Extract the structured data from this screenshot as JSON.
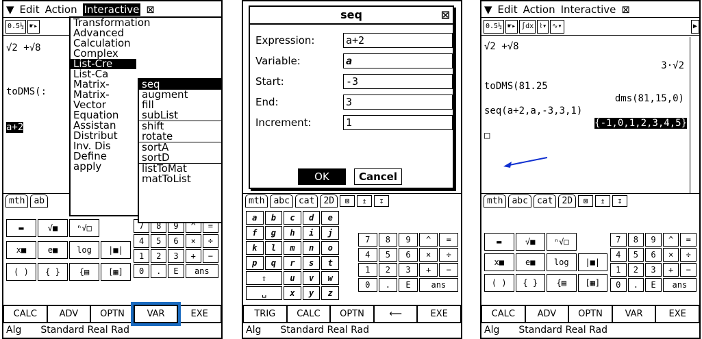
{
  "p1": {
    "menubar": {
      "down_icon": "▼",
      "edit": "Edit",
      "action": "Action",
      "interactive": "Interactive",
      "close": "⊠"
    },
    "menu": [
      "Transformation",
      "Advanced",
      "Calculation",
      "Complex",
      "List-Cre",
      "List-Ca",
      "Matrix-",
      "Matrix-",
      "Vector",
      "Equation",
      "Assistan",
      "Distribut",
      "Inv. Dis",
      "Define",
      "apply"
    ],
    "submenu": [
      "seq",
      "augment",
      "fill",
      "subList",
      "shift",
      "rotate",
      "sortA",
      "sortD",
      "listToMat",
      "matToList"
    ],
    "work": [
      "√2 +√8",
      "toDMS(:",
      "a+2"
    ],
    "tabs": [
      "mth",
      "ab"
    ],
    "bottom": [
      "CALC",
      "ADV",
      "OPTN",
      "VAR",
      "EXE"
    ],
    "status": [
      "Alg",
      "Standard Real Rad"
    ]
  },
  "p2": {
    "title": "seq",
    "fields": [
      {
        "label": "Expression:",
        "value": "a+2"
      },
      {
        "label": "Variable:",
        "value": "a"
      },
      {
        "label": "Start:",
        "value": "-3"
      },
      {
        "label": "End:",
        "value": "3"
      },
      {
        "label": "Increment:",
        "value": "1"
      }
    ],
    "ok": "OK",
    "cancel": "Cancel",
    "tabs": [
      "mth",
      "abc",
      "cat",
      "2D"
    ],
    "letters": [
      "a",
      "b",
      "c",
      "d",
      "e",
      "f",
      "g",
      "h",
      "i",
      "j",
      "k",
      "l",
      "m",
      "n",
      "o",
      "p",
      "q",
      "r",
      "s",
      "t",
      "u",
      "v",
      "w",
      "x",
      "y",
      "z"
    ],
    "bottom": [
      "TRIG",
      "CALC",
      "OPTN",
      "⟵",
      "EXE"
    ],
    "status": [
      "Alg",
      "Standard Real Rad"
    ]
  },
  "p3": {
    "menubar": {
      "down_icon": "▼",
      "edit": "Edit",
      "action": "Action",
      "interactive": "Interactive",
      "close": "⊠"
    },
    "work": [
      "√2 +√8",
      "3·√2",
      "toDMS(81.25",
      "dms(81,15,0)",
      "seq(a+2,a,-3,3,1)",
      "{-1,0,1,2,3,4,5}"
    ],
    "tabs": [
      "mth",
      "abc",
      "cat",
      "2D"
    ],
    "bottom": [
      "CALC",
      "ADV",
      "OPTN",
      "VAR",
      "EXE"
    ],
    "status": [
      "Alg",
      "Standard Real Rad"
    ]
  },
  "keys": {
    "num": [
      "7",
      "8",
      "9",
      "^",
      "=",
      "4",
      "5",
      "6",
      "×",
      "÷",
      "1",
      "2",
      "3",
      "+",
      "−",
      "0",
      ".",
      "E",
      "ans"
    ]
  },
  "colors": {
    "highlight": "#1a6bc0",
    "arrow": "#1030d0"
  }
}
